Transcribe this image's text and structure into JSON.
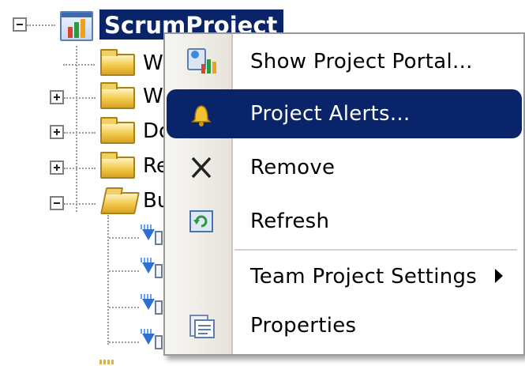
{
  "tree": {
    "project_label": "ScrumProject",
    "children": [
      {
        "label": "W",
        "expander": "none",
        "folder": "closed"
      },
      {
        "label": "W",
        "expander": "plus",
        "folder": "closed"
      },
      {
        "label": "Do",
        "expander": "plus",
        "folder": "closed"
      },
      {
        "label": "Re",
        "expander": "plus",
        "folder": "closed"
      },
      {
        "label": "Bu",
        "expander": "minus",
        "folder": "open"
      }
    ]
  },
  "context_menu": {
    "items": [
      {
        "label": "Show Project Portal...",
        "icon": "project-portal-icon",
        "highlighted": false
      },
      {
        "label": "Project Alerts...",
        "icon": "bell-icon",
        "highlighted": true
      },
      {
        "label": "Remove",
        "icon": "remove-x-icon",
        "highlighted": false
      },
      {
        "label": "Refresh",
        "icon": "refresh-icon",
        "highlighted": false
      },
      {
        "label": "Team Project Settings",
        "icon": null,
        "highlighted": false,
        "has_submenu": true
      },
      {
        "label": "Properties",
        "icon": "properties-icon",
        "highlighted": false
      }
    ]
  },
  "colors": {
    "selection": "#0a246a",
    "menu_gutter": "#ece9e1",
    "tree_lines": "#9c9c9c"
  }
}
